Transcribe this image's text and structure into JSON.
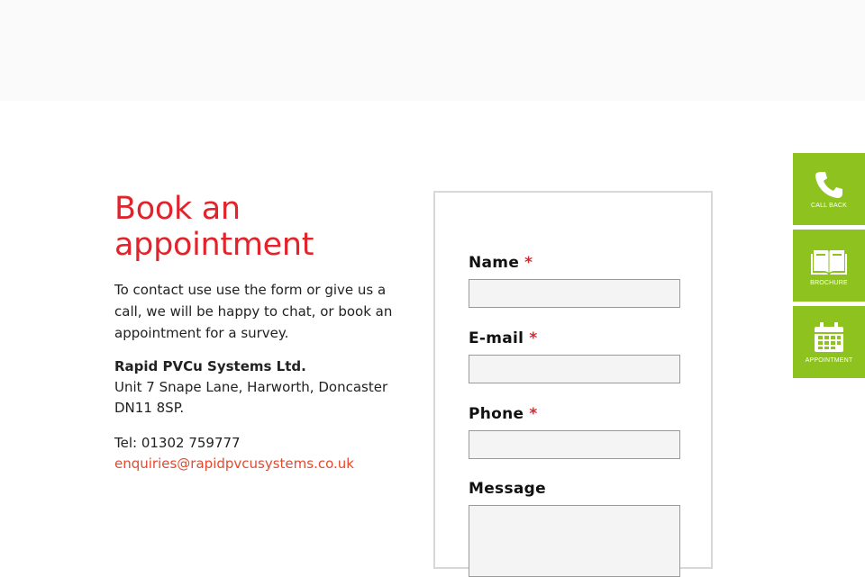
{
  "header": {},
  "appointment": {
    "title_line1": "Book an",
    "title_line2": "appointment",
    "intro": "To contact use use the form or give us a call, we will be happy to chat, or book an appointment for a survey.",
    "company_name": "Rapid PVCu Systems Ltd.",
    "address": "Unit 7 Snape Lane, Harworth, Doncaster DN11 8SP.",
    "tel": "Tel: 01302 759777",
    "email": "enquiries@rapidpvcusystems.co.uk"
  },
  "form": {
    "name_label": "Name",
    "email_label": "E-mail",
    "phone_label": "Phone",
    "message_label": "Message",
    "required_marker": "*",
    "name_value": "",
    "email_value": "",
    "phone_value": "",
    "message_value": ""
  },
  "side_buttons": [
    {
      "label": "CALL BACK",
      "icon": "phone-icon"
    },
    {
      "label": "BROCHURE",
      "icon": "book-icon"
    },
    {
      "label": "APPOINTMENT",
      "icon": "calendar-icon"
    }
  ],
  "colors": {
    "brand_red": "#e3232b",
    "link": "#e34a2f",
    "side_green": "#8dc21f"
  }
}
